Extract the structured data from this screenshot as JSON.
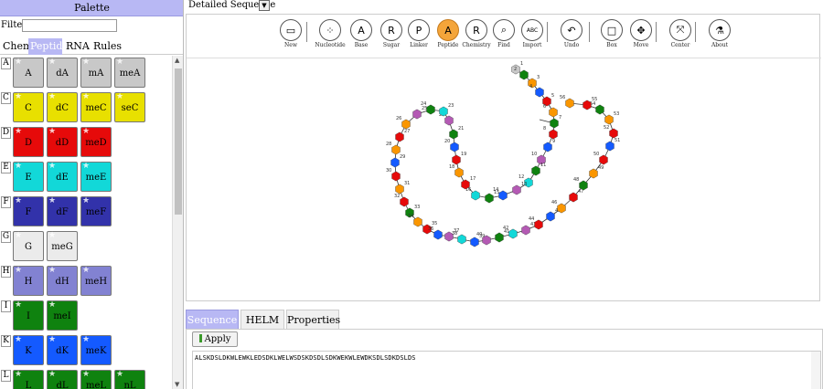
{
  "palette": {
    "title": "Palette",
    "filter_label": "Filter:",
    "filter_value": "",
    "tabs": [
      {
        "label": "Chem",
        "active": false
      },
      {
        "label": "Peptide",
        "active": true
      },
      {
        "label": "RNA",
        "active": false
      },
      {
        "label": "Rules",
        "active": false
      }
    ],
    "rows": [
      {
        "letter": "A",
        "color": "#c8c8c8",
        "text_color": "#000",
        "monomers": [
          "A",
          "dA",
          "mA",
          "meA"
        ]
      },
      {
        "letter": "C",
        "color": "#e8e000",
        "text_color": "#000",
        "monomers": [
          "C",
          "dC",
          "meC",
          "seC"
        ]
      },
      {
        "letter": "D",
        "color": "#e60a0a",
        "text_color": "#000",
        "monomers": [
          "D",
          "dD",
          "meD"
        ]
      },
      {
        "letter": "E",
        "color": "#12d8d8",
        "text_color": "#000",
        "monomers": [
          "E",
          "dE",
          "meE"
        ]
      },
      {
        "letter": "F",
        "color": "#3232aa",
        "text_color": "#000",
        "monomers": [
          "F",
          "dF",
          "meF"
        ]
      },
      {
        "letter": "G",
        "color": "#ebebeb",
        "text_color": "#000",
        "monomers": [
          "G",
          "meG"
        ]
      },
      {
        "letter": "H",
        "color": "#8282d2",
        "text_color": "#000",
        "monomers": [
          "H",
          "dH",
          "meH"
        ]
      },
      {
        "letter": "I",
        "color": "#0f820f",
        "text_color": "#000",
        "monomers": [
          "I",
          "meI"
        ]
      },
      {
        "letter": "K",
        "color": "#145aff",
        "text_color": "#000",
        "monomers": [
          "K",
          "dK",
          "meK"
        ]
      },
      {
        "letter": "L",
        "color": "#0f820f",
        "text_color": "#000",
        "monomers": [
          "L",
          "dL",
          "meL",
          "nL"
        ]
      }
    ]
  },
  "editor": {
    "view_label": "Detailed Sequence",
    "toolbar": [
      {
        "name": "new-button",
        "icon": "folder-icon",
        "label": "New",
        "glyph": "▭",
        "active": false
      },
      {
        "name": "nucleotide-button",
        "icon": "nucleotide-icon",
        "label": "Nucleotide",
        "glyph": "⁘",
        "active": false
      },
      {
        "name": "base-button",
        "icon": "base-icon",
        "label": "Base",
        "glyph": "A",
        "active": false
      },
      {
        "name": "sugar-button",
        "icon": "sugar-icon",
        "label": "Sugar",
        "glyph": "R",
        "active": false
      },
      {
        "name": "linker-button",
        "icon": "linker-icon",
        "label": "Linker",
        "glyph": "P",
        "active": false
      },
      {
        "name": "peptide-button",
        "icon": "peptide-icon",
        "label": "Peptide",
        "glyph": "A",
        "active": true
      },
      {
        "name": "chemistry-button",
        "icon": "chemistry-icon",
        "label": "Chemistry",
        "glyph": "R",
        "active": false
      },
      {
        "name": "find-button",
        "icon": "magnifier-icon",
        "label": "Find",
        "glyph": "⌕",
        "active": false
      },
      {
        "name": "import-button",
        "icon": "import-icon",
        "label": "Import",
        "glyph": "ABC",
        "active": false
      },
      {
        "name": "undo-button",
        "icon": "undo-icon",
        "label": "Undo",
        "glyph": "↶",
        "active": false
      },
      {
        "name": "box-button",
        "icon": "box-icon",
        "label": "Box",
        "glyph": "□",
        "active": false
      },
      {
        "name": "move-button",
        "icon": "move-icon",
        "label": "Move",
        "glyph": "✥",
        "active": false
      },
      {
        "name": "center-button",
        "icon": "center-icon",
        "label": "Center",
        "glyph": "⤧",
        "active": false
      },
      {
        "name": "about-button",
        "icon": "flask-icon",
        "label": "About",
        "glyph": "⚗",
        "active": false
      }
    ],
    "sequence": "ALSKDSLDKWLEWKLEDSDKLWELWSDSKDSDLSDKWEKWLEWDKSDLSDKDSLDS",
    "colors": {
      "A": "#c8c8c8",
      "L": "#0f820f",
      "S": "#fa9600",
      "K": "#145aff",
      "D": "#e60a0a",
      "W": "#b45ab4",
      "E": "#12d8d8"
    }
  },
  "bottom": {
    "tabs": [
      {
        "label": "Sequence",
        "active": true
      },
      {
        "label": "HELM",
        "active": false
      },
      {
        "label": "Properties",
        "active": false
      }
    ],
    "apply_label": "Apply",
    "sequence_text": "ALSKDSLDKWLEWKLEDSDKLWELWSDSKDSDLSDKWEKWLEWDKSDLSDKDSLDS"
  }
}
